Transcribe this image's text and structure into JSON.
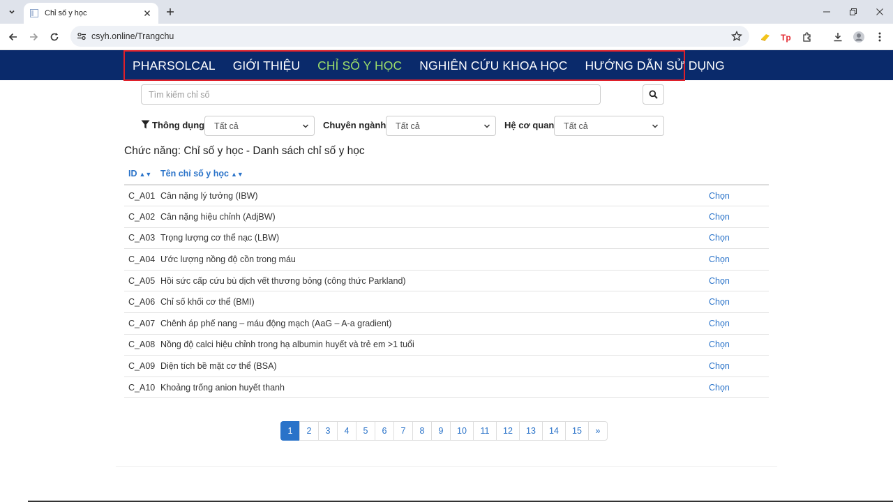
{
  "browser": {
    "tab_title": "Chỉ số y học",
    "url": "csyh.online/Trangchu"
  },
  "site_nav": {
    "items": [
      {
        "label": "PHARSOLCAL",
        "active": false
      },
      {
        "label": "GIỚI THIỆU",
        "active": false
      },
      {
        "label": "CHỈ SỐ Y HỌC",
        "active": true
      },
      {
        "label": "NGHIÊN CỨU KHOA HỌC",
        "active": false
      },
      {
        "label": "HƯỚNG DẪN SỬ DỤNG",
        "active": false
      }
    ]
  },
  "search": {
    "placeholder": "Tìm kiếm chỉ số"
  },
  "filters": {
    "common_label": "Thông dụng:",
    "common_value": "Tất cả",
    "specialty_label": "Chuyên ngành:",
    "specialty_value": "Tất cả",
    "organ_label": "Hệ cơ quan:",
    "organ_value": "Tất cả"
  },
  "function_title": "Chức năng: Chỉ số y học - Danh sách chỉ số y học",
  "table": {
    "headers": [
      "ID",
      "Tên chỉ số y học"
    ],
    "select_label": "Chọn",
    "rows": [
      {
        "id": "C_A01",
        "name": "Cân nặng lý tưởng (IBW)"
      },
      {
        "id": "C_A02",
        "name": "Cân nặng hiệu chỉnh (AdjBW)"
      },
      {
        "id": "C_A03",
        "name": "Trọng lượng cơ thể nạc (LBW)"
      },
      {
        "id": "C_A04",
        "name": "Ước lượng nồng độ cồn trong máu"
      },
      {
        "id": "C_A05",
        "name": "Hồi sức cấp cứu bù dịch vết thương bỏng (công thức Parkland)"
      },
      {
        "id": "C_A06",
        "name": "Chỉ số khối cơ thể (BMI)"
      },
      {
        "id": "C_A07",
        "name": "Chênh áp phế nang – máu động mạch (AaG – A-a gradient)"
      },
      {
        "id": "C_A08",
        "name": "Nồng độ calci hiệu chỉnh trong hạ albumin huyết và trẻ em >1 tuổi"
      },
      {
        "id": "C_A09",
        "name": "Diện tích bề mặt cơ thể (BSA)"
      },
      {
        "id": "C_A10",
        "name": "Khoảng trống anion huyết thanh"
      }
    ]
  },
  "pagination": {
    "pages": [
      "1",
      "2",
      "3",
      "4",
      "5",
      "6",
      "7",
      "8",
      "9",
      "10",
      "11",
      "12",
      "13",
      "14",
      "15"
    ],
    "current": "1",
    "next": "»"
  },
  "colors": {
    "nav_bg": "#0a2a6b",
    "nav_active": "#9ee06a",
    "link": "#2a73c9",
    "highlight_border": "#e0202a"
  }
}
